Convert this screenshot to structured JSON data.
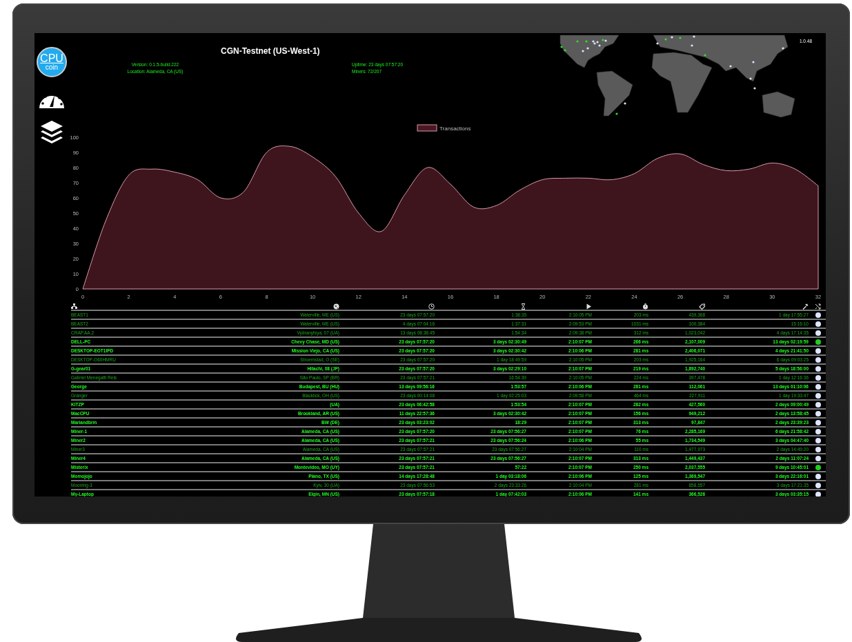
{
  "logo": {
    "top": "CPU",
    "bottom": "coin"
  },
  "header": {
    "title": "CGN-Testnet (US-West-1)",
    "version": "Version: 0.1.5-build.222",
    "location": "Location: Alameda, CA (US)",
    "uptime": "Uptime: 23 days 07:57:20",
    "miners": "Miners: 72/207",
    "build": "1.0.48"
  },
  "chart_data": {
    "type": "area",
    "series": [
      {
        "name": "Transactions",
        "color": "#d99aae",
        "values": [
          0,
          45,
          75,
          79,
          77,
          72,
          60,
          64,
          90,
          94,
          87,
          74,
          50,
          38,
          62,
          80,
          69,
          54,
          55,
          65,
          72,
          73,
          73,
          72,
          76,
          86,
          89,
          82,
          78,
          79,
          83,
          79,
          68
        ]
      }
    ],
    "x": [
      0,
      1,
      2,
      3,
      4,
      5,
      6,
      7,
      8,
      9,
      10,
      11,
      12,
      13,
      14,
      15,
      16,
      17,
      18,
      19,
      20,
      21,
      22,
      23,
      24,
      25,
      26,
      27,
      28,
      29,
      30,
      31,
      32
    ],
    "xlim": [
      0,
      32
    ],
    "ylim": [
      0,
      100
    ],
    "xticks": [
      0,
      2,
      4,
      6,
      8,
      10,
      12,
      14,
      16,
      18,
      20,
      22,
      24,
      26,
      28,
      30,
      32
    ],
    "yticks": [
      0,
      10,
      20,
      30,
      40,
      50,
      60,
      70,
      80,
      90,
      100
    ]
  },
  "table": {
    "rows": [
      {
        "cells": [
          "BEAST1",
          "Waterville, ME (US)",
          "23 days 07:57:20",
          "1:38:35",
          "2:10:05 PM",
          "203 ms",
          "439,368",
          "1 day 17:55:27"
        ],
        "active": false,
        "color": "#dde6ff"
      },
      {
        "cells": [
          "BEAST2",
          "Waterville, ME (US)",
          "4 days 07:04:16",
          "1:37:31",
          "2:09:53 PM",
          "1031 ms",
          "100,384",
          "15:16:10"
        ],
        "active": false,
        "color": "#dde6ff"
      },
      {
        "cells": [
          "CRAP.AA.2",
          "Vydranytsya, 07 (UA)",
          "13 days 08:38:45",
          "1:54:34",
          "2:09:38 PM",
          "312 ms",
          "1,023,042",
          "4 days 17:14:35"
        ],
        "active": false,
        "color": "#dde6ff"
      },
      {
        "cells": [
          "DELL-PC",
          "Chevy Chase, MD (US)",
          "23 days 07:57:20",
          "3 days 02:30:49",
          "2:10:07 PM",
          "266 ms",
          "2,107,009",
          "13 days 02:19:59"
        ],
        "active": true,
        "color": "#22cc22"
      },
      {
        "cells": [
          "DESKTOP-EOT1IPD",
          "Mission Viejo, CA (US)",
          "23 days 07:57:20",
          "3 days 02:30:42",
          "2:10:06 PM",
          "281 ms",
          "2,406,071",
          "4 days 21:41:50"
        ],
        "active": true,
        "color": "#dde6ff"
      },
      {
        "cells": [
          "DESKTOP-O60HMRU",
          "Stroemstad, O (SE)",
          "23 days 07:57:20",
          "1 day 18:49:59",
          "2:10:05 PM",
          "203 ms",
          "1,925,164",
          "6 days 09:03:25"
        ],
        "active": false,
        "color": "#dde6ff"
      },
      {
        "cells": [
          "G-gear01",
          "Hitachi, 08 (JP)",
          "23 days 07:57:20",
          "3 days 02:29:10",
          "2:10:07 PM",
          "219 ms",
          "1,892,740",
          "5 days 18:56:00"
        ],
        "active": true,
        "color": "#dde6ff"
      },
      {
        "cells": [
          "Gabriel Menegatti Reis",
          "São Paulo, SP (BR)",
          "23 days 07:57:21",
          "16:54:39",
          "2:10:05 PM",
          "224 ms",
          "397,478",
          "1 day 12:16:36"
        ],
        "active": false,
        "color": "#dde6ff"
      },
      {
        "cells": [
          "George",
          "Budapest, BU (HU)",
          "13 days 09:56:16",
          "1:53:57",
          "2:10:06 PM",
          "281 ms",
          "112,061",
          "13 days 01:10:06"
        ],
        "active": true,
        "color": "#dde6ff"
      },
      {
        "cells": [
          "Granger",
          "Blacklick, OH (US)",
          "23 days 00:14:08",
          "1 day 02:25:03",
          "2:09:58 PM",
          "464 ms",
          "227,911",
          "1 day 19:33:47"
        ],
        "active": false,
        "color": "#dde6ff"
      },
      {
        "cells": [
          "KITZP",
          "(UA)",
          "23 days 06:42:58",
          "1:53:54",
          "2:10:07 PM",
          "282 ms",
          "427,560",
          "2 days 09:00:49"
        ],
        "active": true,
        "color": "#dde6ff"
      },
      {
        "cells": [
          "MacCPU",
          "Brookland, AR (US)",
          "11 days 22:57:36",
          "3 days 02:30:42",
          "2:10:07 PM",
          "156 ms",
          "949,212",
          "2 days 13:58:45"
        ],
        "active": true,
        "color": "#dde6ff"
      },
      {
        "cells": [
          "Mariandbrm",
          "BW (DE)",
          "23 days 03:23:02",
          "18:29",
          "2:10:07 PM",
          "313 ms",
          "97,847",
          "2 days 23:39:23"
        ],
        "active": true,
        "color": "#dde6ff"
      },
      {
        "cells": [
          "Miner-1",
          "Alameda, CA (US)",
          "23 days 07:57:20",
          "23 days 07:56:27",
          "2:10:07 PM",
          "76 ms",
          "2,285,169",
          "6 days 21:58:42"
        ],
        "active": true,
        "color": "#dde6ff"
      },
      {
        "cells": [
          "Miner2",
          "Alameda, CA (US)",
          "23 days 07:57:21",
          "23 days 07:56:24",
          "2:10:06 PM",
          "55 ms",
          "1,734,549",
          "3 days 04:47:40"
        ],
        "active": true,
        "color": "#dde6ff"
      },
      {
        "cells": [
          "Miner3",
          "Alameda, CA (US)",
          "23 days 07:57:21",
          "23 days 07:56:27",
          "2:10:04 PM",
          "110 ms",
          "1,477,973",
          "2 days 14:49:20"
        ],
        "active": false,
        "color": "#dde6ff"
      },
      {
        "cells": [
          "Miner4",
          "Alameda, CA (US)",
          "23 days 07:57:21",
          "23 days 07:56:27",
          "2:10:07 PM",
          "313 ms",
          "1,449,437",
          "2 days 11:07:24"
        ],
        "active": true,
        "color": "#dde6ff"
      },
      {
        "cells": [
          "Misterix",
          "Montevideo, MO (UY)",
          "23 days 07:57:21",
          "57:22",
          "2:10:07 PM",
          "250 ms",
          "2,037,555",
          "9 days 10:45:01"
        ],
        "active": true,
        "color": "#22cc22"
      },
      {
        "cells": [
          "Momojojo",
          "Plano, TX (US)",
          "14 days 17:28:48",
          "1 day 03:18:06",
          "2:10:06 PM",
          "125 ms",
          "1,369,547",
          "3 days 22:16:01"
        ],
        "active": true,
        "color": "#dde6ff"
      },
      {
        "cells": [
          "Mooning-3",
          "Kyiv, 30 (UA)",
          "23 days 07:56:53",
          "2 days 23:33:26",
          "2:10:04 PM",
          "281 ms",
          "858,557",
          "3 days 17:21:35"
        ],
        "active": false,
        "color": "#dde6ff"
      },
      {
        "cells": [
          "My-Laptop",
          "Elgin, MN (US)",
          "23 days 07:57:18",
          "1 day 07:42:03",
          "2:10:06 PM",
          "141 ms",
          "366,526",
          "3 days 03:35:15"
        ],
        "active": true,
        "color": "#dde6ff"
      }
    ]
  }
}
